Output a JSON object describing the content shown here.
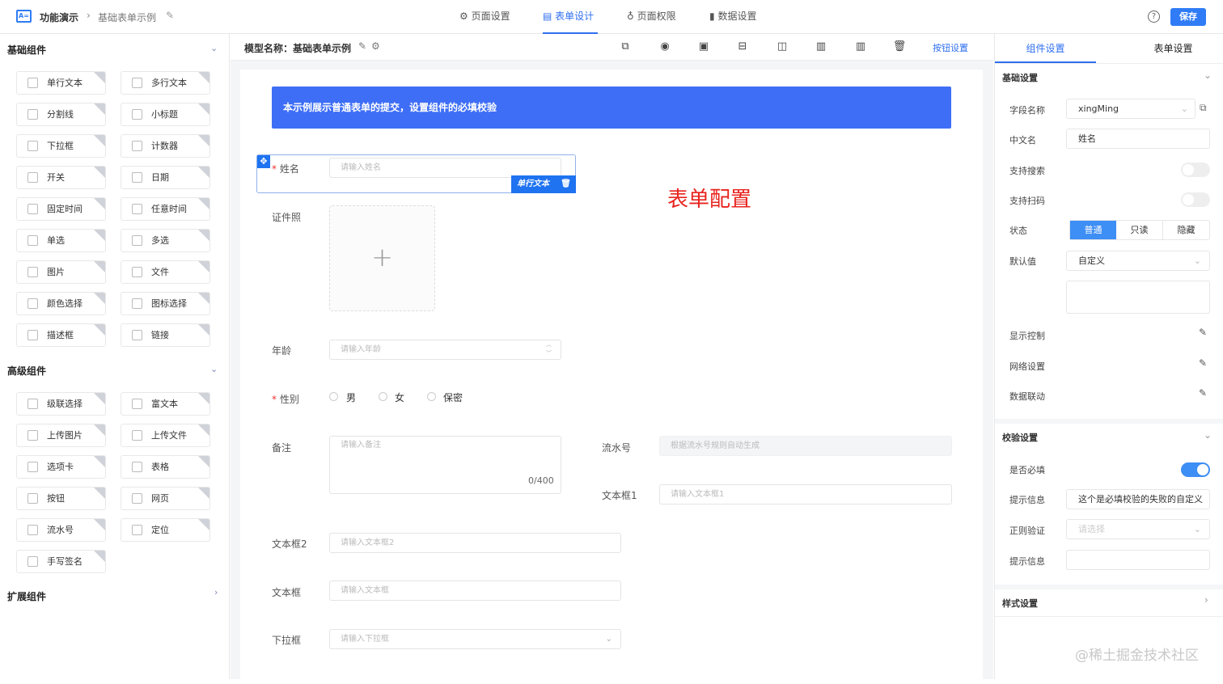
{
  "header": {
    "app": "功能演示",
    "page": "基础表单示例",
    "tabs": [
      {
        "label": "页面设置",
        "icon": "gear-icon"
      },
      {
        "label": "表单设计",
        "icon": "document-icon"
      },
      {
        "label": "页面权限",
        "icon": "key-icon"
      },
      {
        "label": "数据设置",
        "icon": "bar-chart-icon"
      }
    ],
    "active_tab": "表单设计",
    "help": "?",
    "save": "保存"
  },
  "sidebar": {
    "basic": {
      "title": "基础组件",
      "items": [
        "单行文本",
        "多行文本",
        "分割线",
        "小标题",
        "下拉框",
        "计数器",
        "开关",
        "日期",
        "固定时间",
        "任意时间",
        "单选",
        "多选",
        "图片",
        "文件",
        "颜色选择",
        "图标选择",
        "描述框",
        "链接"
      ]
    },
    "advanced": {
      "title": "高级组件",
      "items": [
        "级联选择",
        "富文本",
        "上传图片",
        "上传文件",
        "选项卡",
        "表格",
        "按钮",
        "网页",
        "流水号",
        "定位",
        "手写签名"
      ]
    },
    "extension": {
      "title": "扩展组件"
    }
  },
  "toolbar": {
    "model_label": "模型名称：基础表单示例",
    "button_settings": "按钮设置",
    "icons": [
      "link-icon",
      "eye-icon",
      "code-icon",
      "rows-icon",
      "two-columns-icon",
      "three-columns-icon",
      "four-columns-icon",
      "trash-icon"
    ]
  },
  "form": {
    "banner": "本示例展示普通表单的提交，设置组件的必填校验",
    "annotation": "表单配置",
    "selected_tag": "单行文本",
    "fields": {
      "name": {
        "label": "姓名",
        "placeholder": "请输入姓名"
      },
      "photo": {
        "label": "证件照",
        "plus": "+"
      },
      "age": {
        "label": "年龄",
        "placeholder": "请输入年龄"
      },
      "gender": {
        "label": "性别",
        "options": [
          "男",
          "女",
          "保密"
        ]
      },
      "remark": {
        "label": "备注",
        "placeholder": "请输入备注",
        "counter": "0/400"
      },
      "serial": {
        "label": "流水号",
        "placeholder": "根据流水号规则自动生成"
      },
      "text1": {
        "label": "文本框1",
        "placeholder": "请输入文本框1"
      },
      "text2": {
        "label": "文本框2",
        "placeholder": "请输入文本框2"
      },
      "text": {
        "label": "文本框",
        "placeholder": "请输入文本框"
      },
      "select": {
        "label": "下拉框",
        "placeholder": "请输入下拉框"
      }
    }
  },
  "right": {
    "tabs": [
      "组件设置",
      "表单设置"
    ],
    "basic": {
      "title": "基础设置",
      "field_name_label": "字段名称",
      "field_name": "xingMing",
      "cn_label": "中文名",
      "cn_name": "姓名",
      "search_label": "支持搜索",
      "search_on": false,
      "scan_label": "支持扫码",
      "scan_on": false,
      "state_label": "状态",
      "states": [
        "普通",
        "只读",
        "隐藏"
      ],
      "state_selected": "普通",
      "default_label": "默认值",
      "default_value": "自定义",
      "display_label": "显示控制",
      "network_label": "网络设置",
      "linkage_label": "数据联动"
    },
    "validation": {
      "title": "校验设置",
      "required_label": "是否必填",
      "required_on": true,
      "msg_label": "提示信息",
      "msg_value": "这个是必填校验的失败的自定义",
      "regex_label": "正则验证",
      "regex_placeholder": "请选择",
      "msg2_label": "提示信息"
    },
    "style": {
      "title": "样式设置"
    }
  },
  "watermark": "@稀土掘金技术社区",
  "colors": {
    "accent": "#2f7cf6",
    "banner": "#3e6ef6",
    "annotation": "#e8231e"
  }
}
